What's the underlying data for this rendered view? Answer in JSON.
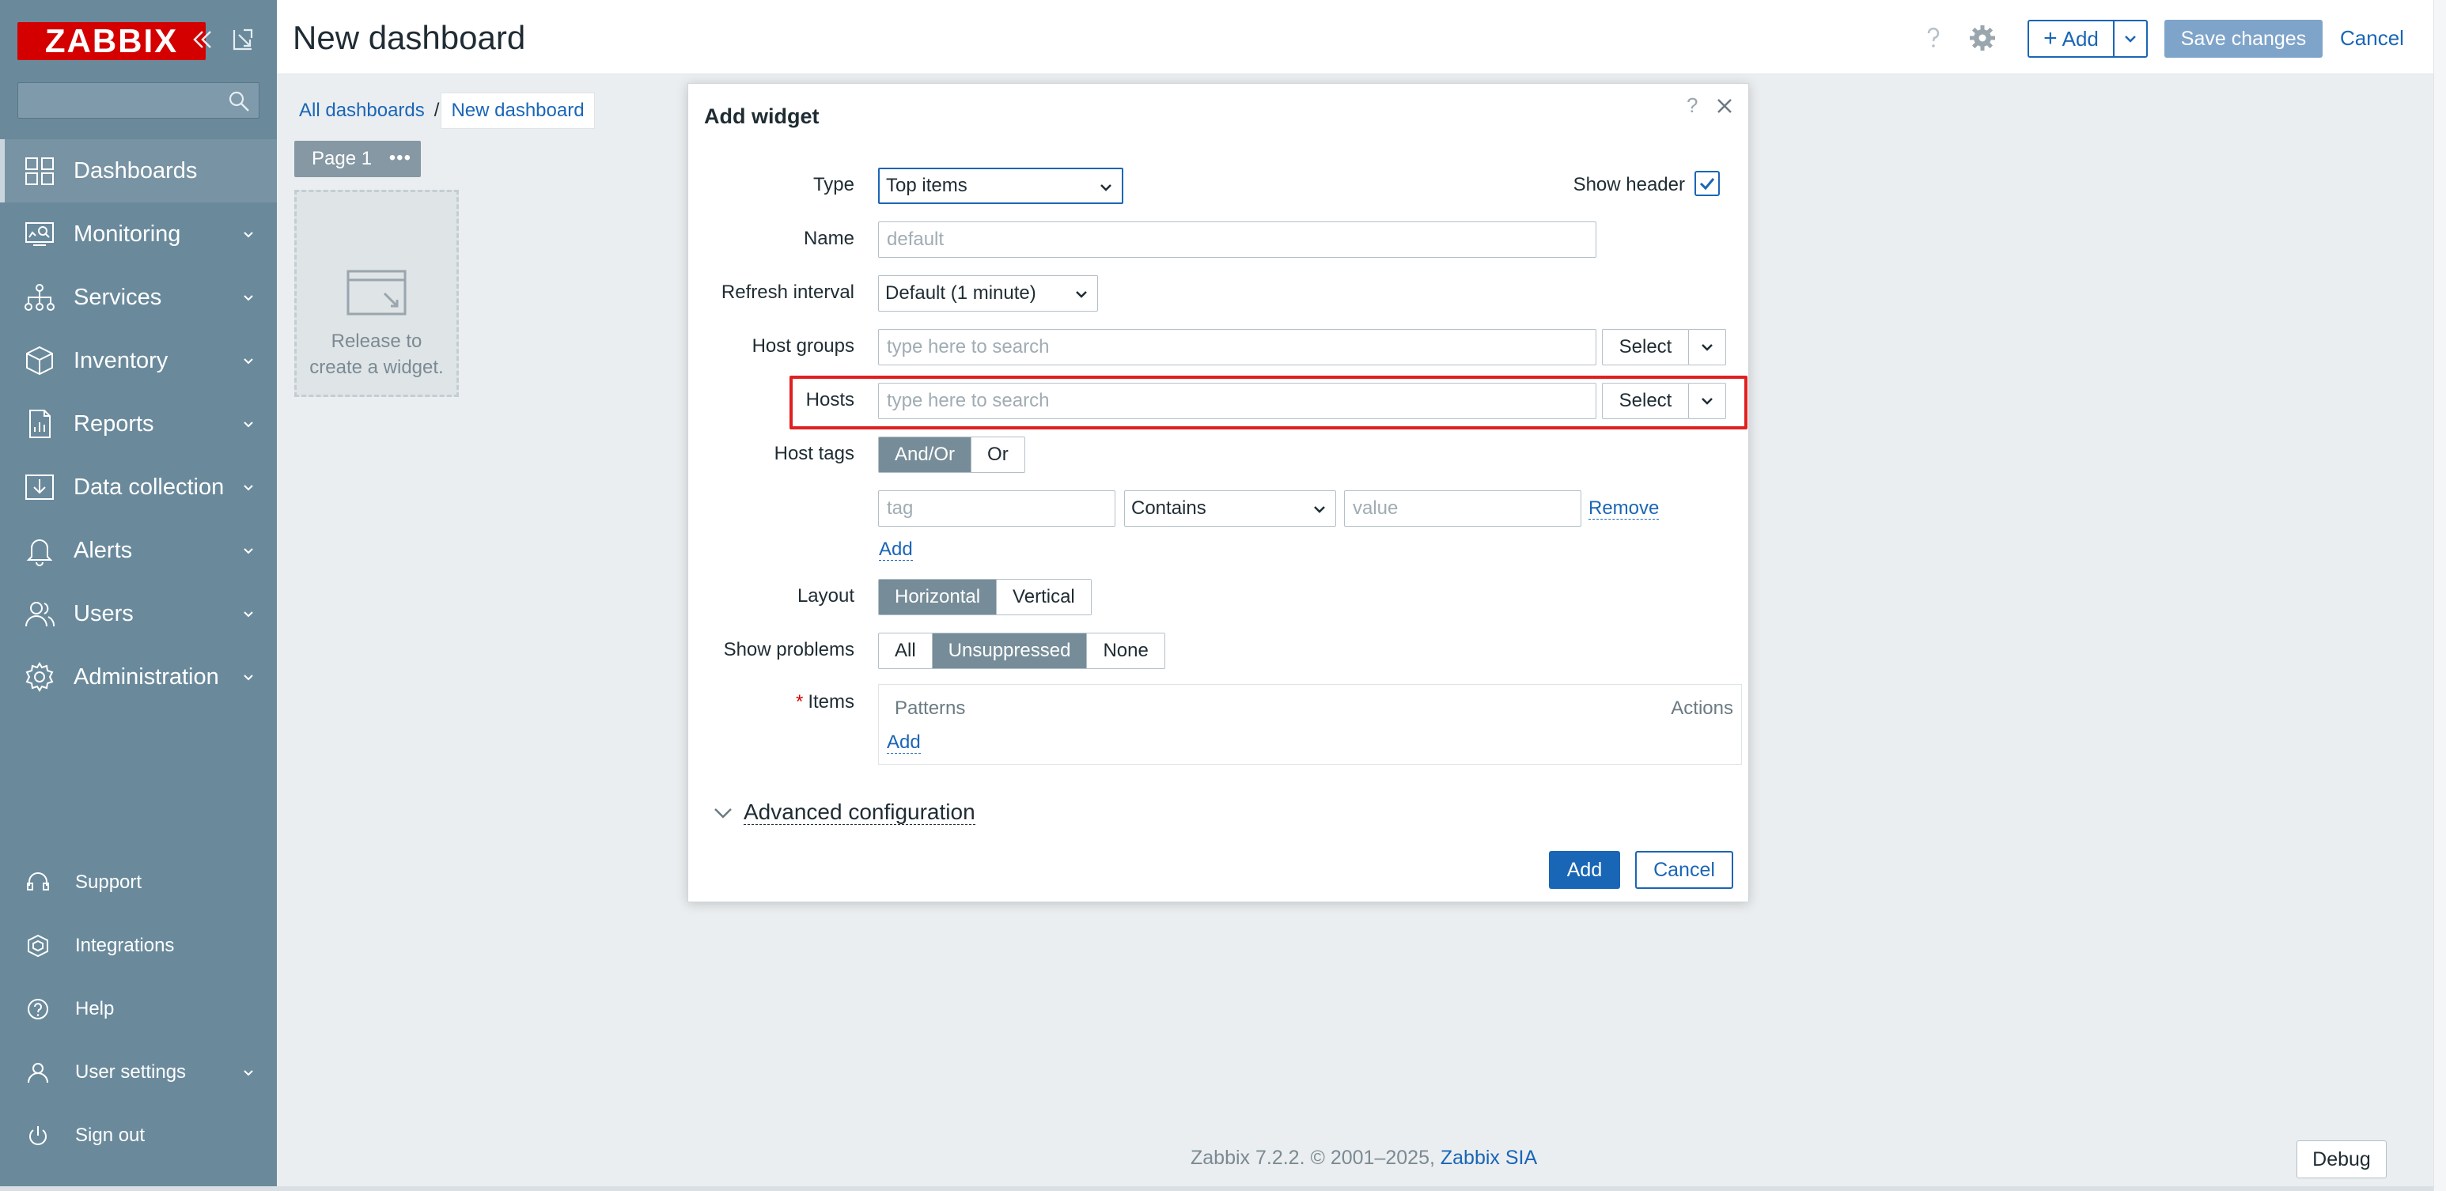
{
  "sidebar": {
    "logo": "ZABBIX",
    "search": {
      "value": "",
      "placeholder": ""
    },
    "nav": [
      {
        "label": "Dashboards",
        "icon": "dashboards-icon",
        "active": true
      },
      {
        "label": "Monitoring",
        "icon": "monitoring-icon"
      },
      {
        "label": "Services",
        "icon": "services-icon"
      },
      {
        "label": "Inventory",
        "icon": "inventory-icon"
      },
      {
        "label": "Reports",
        "icon": "reports-icon"
      },
      {
        "label": "Data collection",
        "icon": "data-collection-icon"
      },
      {
        "label": "Alerts",
        "icon": "alerts-icon"
      },
      {
        "label": "Users",
        "icon": "users-icon"
      },
      {
        "label": "Administration",
        "icon": "administration-icon"
      }
    ],
    "bottom": [
      {
        "label": "Support",
        "icon": "support-icon"
      },
      {
        "label": "Integrations",
        "icon": "integrations-icon"
      },
      {
        "label": "Help",
        "icon": "help-icon"
      },
      {
        "label": "User settings",
        "icon": "user-settings-icon"
      },
      {
        "label": "Sign out",
        "icon": "sign-out-icon"
      }
    ]
  },
  "header": {
    "title": "New dashboard",
    "add_label": "Add",
    "save_label": "Save changes",
    "cancel_label": "Cancel"
  },
  "breadcrumb": {
    "all": "All dashboards",
    "separator": "/",
    "current": "New dashboard"
  },
  "page_tab": {
    "label": "Page 1",
    "menu": "•••"
  },
  "placeholder": {
    "text": "Release to create a widget."
  },
  "footer": {
    "text": "Zabbix 7.2.2. © 2001–2025, ",
    "link": "Zabbix SIA",
    "debug": "Debug"
  },
  "dialog": {
    "title": "Add widget",
    "help": "?",
    "labels": {
      "type": "Type",
      "show_header": "Show header",
      "name": "Name",
      "refresh": "Refresh interval",
      "host_groups": "Host groups",
      "hosts": "Hosts",
      "host_tags": "Host tags",
      "layout": "Layout",
      "show_problems": "Show problems",
      "items": "Items",
      "required": "*"
    },
    "type_value": "Top items",
    "show_header_checked": true,
    "name_placeholder": "default",
    "refresh_value": "Default (1 minute)",
    "host_groups_placeholder": "type here to search",
    "hosts_placeholder": "type here to search",
    "select_label": "Select",
    "host_tags": {
      "options": [
        "And/Or",
        "Or"
      ],
      "selected": "And/Or",
      "tag_placeholder": "tag",
      "operator": "Contains",
      "value_placeholder": "value",
      "remove": "Remove",
      "add": "Add"
    },
    "layout": {
      "options": [
        "Horizontal",
        "Vertical"
      ],
      "selected": "Horizontal"
    },
    "show_problems": {
      "options": [
        "All",
        "Unsuppressed",
        "None"
      ],
      "selected": "Unsuppressed"
    },
    "items_table": {
      "col_patterns": "Patterns",
      "col_actions": "Actions",
      "add": "Add"
    },
    "advanced": "Advanced configuration",
    "add_button": "Add",
    "cancel_button": "Cancel"
  },
  "colors": {
    "sidebar": "#6a8a9c",
    "accent": "#1a66b6",
    "logo": "#d40000",
    "highlight": "#e02020"
  }
}
